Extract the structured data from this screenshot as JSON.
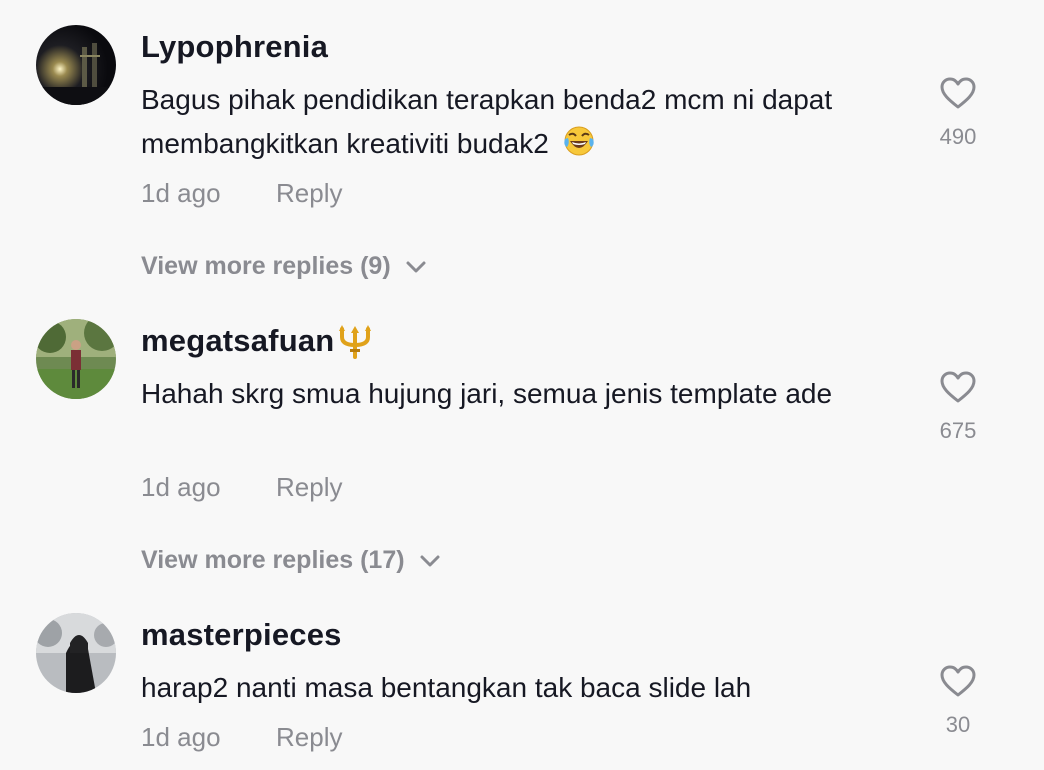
{
  "comments": [
    {
      "username": "Lypophrenia",
      "text": "Bagus pihak pendidikan terapkan benda2 mcm ni dapat membangkitkan kreativiti budak2",
      "emoji": "tears-of-joy-emoji",
      "time": "1d ago",
      "reply": "Reply",
      "likes": "490",
      "more_replies": "View more replies (9)"
    },
    {
      "username": "megatsafuan",
      "badge": "trident-emoji",
      "text": "Hahah skrg smua hujung jari, semua jenis template ade",
      "time": "1d ago",
      "reply": "Reply",
      "likes": "675",
      "more_replies": "View more replies (17)"
    },
    {
      "username": "masterpieces",
      "text": "harap2 nanti masa bentangkan tak baca slide lah",
      "time": "1d ago",
      "reply": "Reply",
      "likes": "30"
    }
  ],
  "colors": {
    "background": "#f8f8f8",
    "primary_text": "#161823",
    "secondary_text": "#8a8b91"
  },
  "icons": {
    "like": "heart-outline-icon",
    "expand": "chevron-down-icon"
  }
}
